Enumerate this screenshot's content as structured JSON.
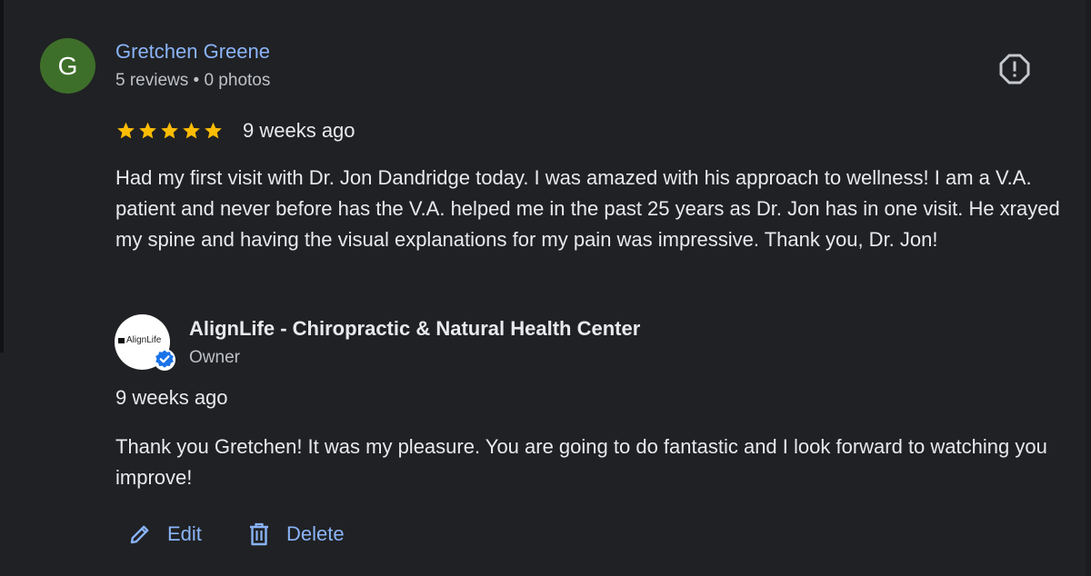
{
  "reviewer": {
    "initial": "G",
    "name": "Gretchen Greene",
    "meta": "5 reviews • 0 photos",
    "avatar_color": "#3e6f2a"
  },
  "report_icon": "report-flag-icon",
  "review": {
    "rating": 5,
    "max_rating": 5,
    "star_color": "#fbbc04",
    "date": "9 weeks ago",
    "text": "Had my first visit with Dr. Jon Dandridge today. I was amazed with his approach to wellness! I am a V.A. patient and never before has the V.A. helped me in the past 25 years as Dr. Jon has in one visit. He xrayed my spine and having the visual explanations for my pain was impressive. Thank you, Dr. Jon!"
  },
  "owner": {
    "logo_text": "AlignLife",
    "name": "AlignLife - Chiropractic & Natural Health Center",
    "role": "Owner",
    "verified_color": "#1a73e8"
  },
  "reply": {
    "date": "9 weeks ago",
    "text": "Thank you Gretchen! It was my pleasure. You are going to do fantastic and I look forward to watching you improve!"
  },
  "actions": {
    "edit_label": "Edit",
    "edit_icon": "pencil-icon",
    "delete_label": "Delete",
    "delete_icon": "trash-icon"
  },
  "colors": {
    "background": "#202124",
    "link": "#8ab4f8",
    "text": "#e8eaed",
    "secondary_text": "#bdc1c6"
  }
}
